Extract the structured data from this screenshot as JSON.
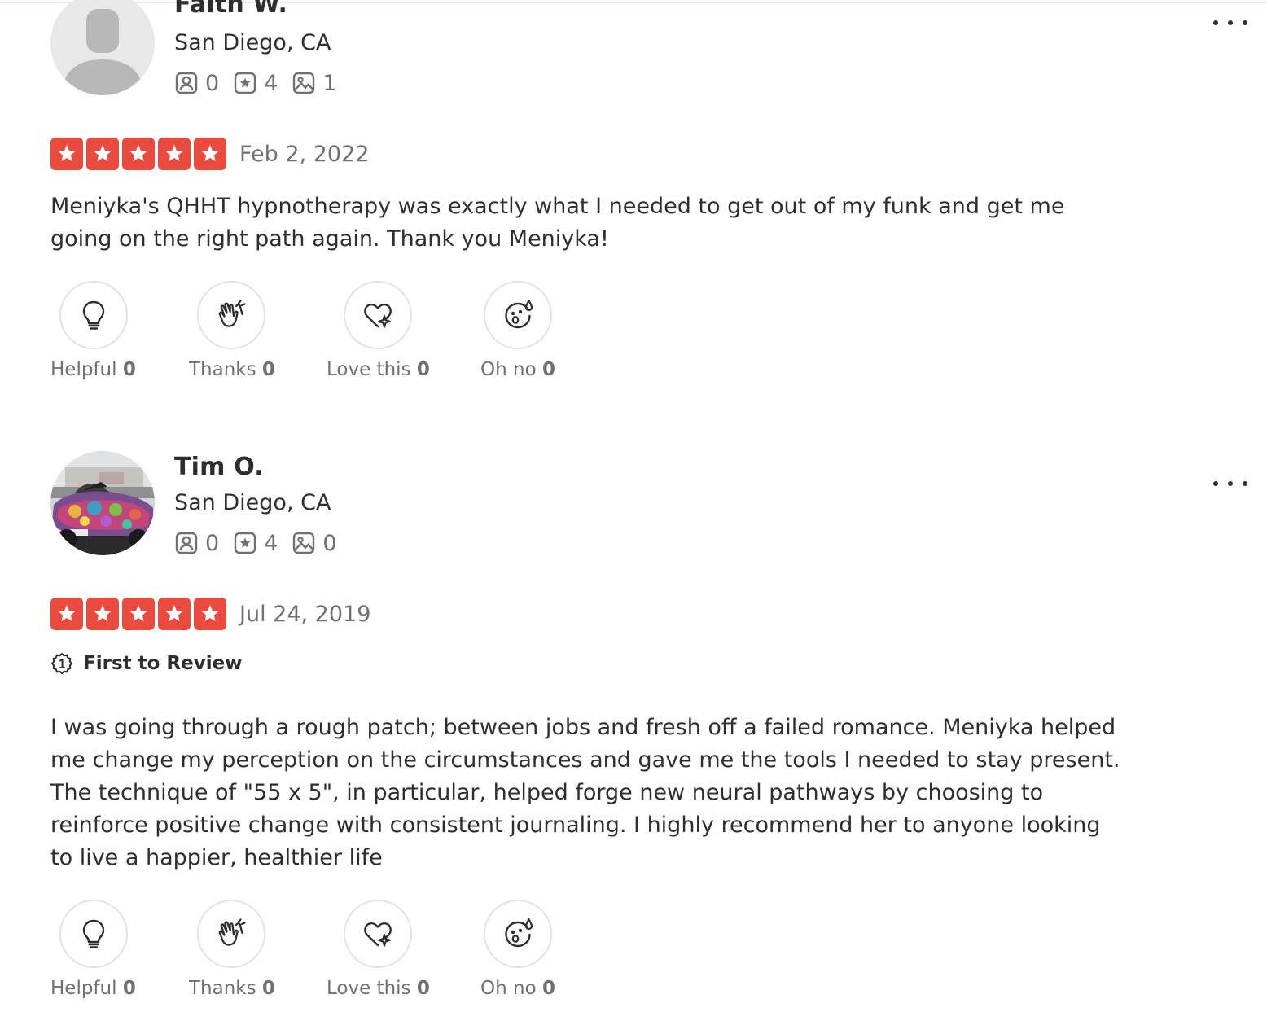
{
  "reviews": [
    {
      "user_name": "Faith W.",
      "location": "San Diego, CA",
      "stats": {
        "friends": "0",
        "reviews": "4",
        "photos": "1"
      },
      "rating": 5,
      "date": "Feb 2, 2022",
      "text": "Meniyka's QHHT hypnotherapy was exactly what I needed to get out of my funk and get me going on the right path again. Thank you Meniyka!",
      "reactions": [
        {
          "label": "Helpful",
          "count": "0"
        },
        {
          "label": "Thanks",
          "count": "0"
        },
        {
          "label": "Love this",
          "count": "0"
        },
        {
          "label": "Oh no",
          "count": "0"
        }
      ]
    },
    {
      "user_name": "Tim O.",
      "location": "San Diego, CA",
      "stats": {
        "friends": "0",
        "reviews": "4",
        "photos": "0"
      },
      "rating": 5,
      "date": "Jul 24, 2019",
      "badge": "First to Review",
      "text": "I was going through a rough patch; between jobs and fresh off a failed romance. Meniyka helped me change my perception on the circumstances and gave me the tools I needed to stay present. The technique of \"55 x 5\", in particular, helped forge new neural pathways by choosing to reinforce positive change with consistent journaling. I highly recommend her to anyone looking to live a happier, healthier life",
      "reactions": [
        {
          "label": "Helpful",
          "count": "0"
        },
        {
          "label": "Thanks",
          "count": "0"
        },
        {
          "label": "Love this",
          "count": "0"
        },
        {
          "label": "Oh no",
          "count": "0"
        }
      ]
    }
  ],
  "icons": {
    "star": "star-icon",
    "friends": "friends-icon",
    "reviews": "review-count-icon",
    "photos": "photo-count-icon",
    "more": "more-options-icon",
    "helpful": "lightbulb-icon",
    "thanks": "clapping-hands-icon",
    "love": "heart-sparkle-icon",
    "ohno": "sad-face-icon",
    "first_to_review": "first-badge-icon"
  },
  "colors": {
    "star_red": "#eb4b3f",
    "text_dark": "#2d2e2f",
    "text_gray": "#6e7072"
  }
}
